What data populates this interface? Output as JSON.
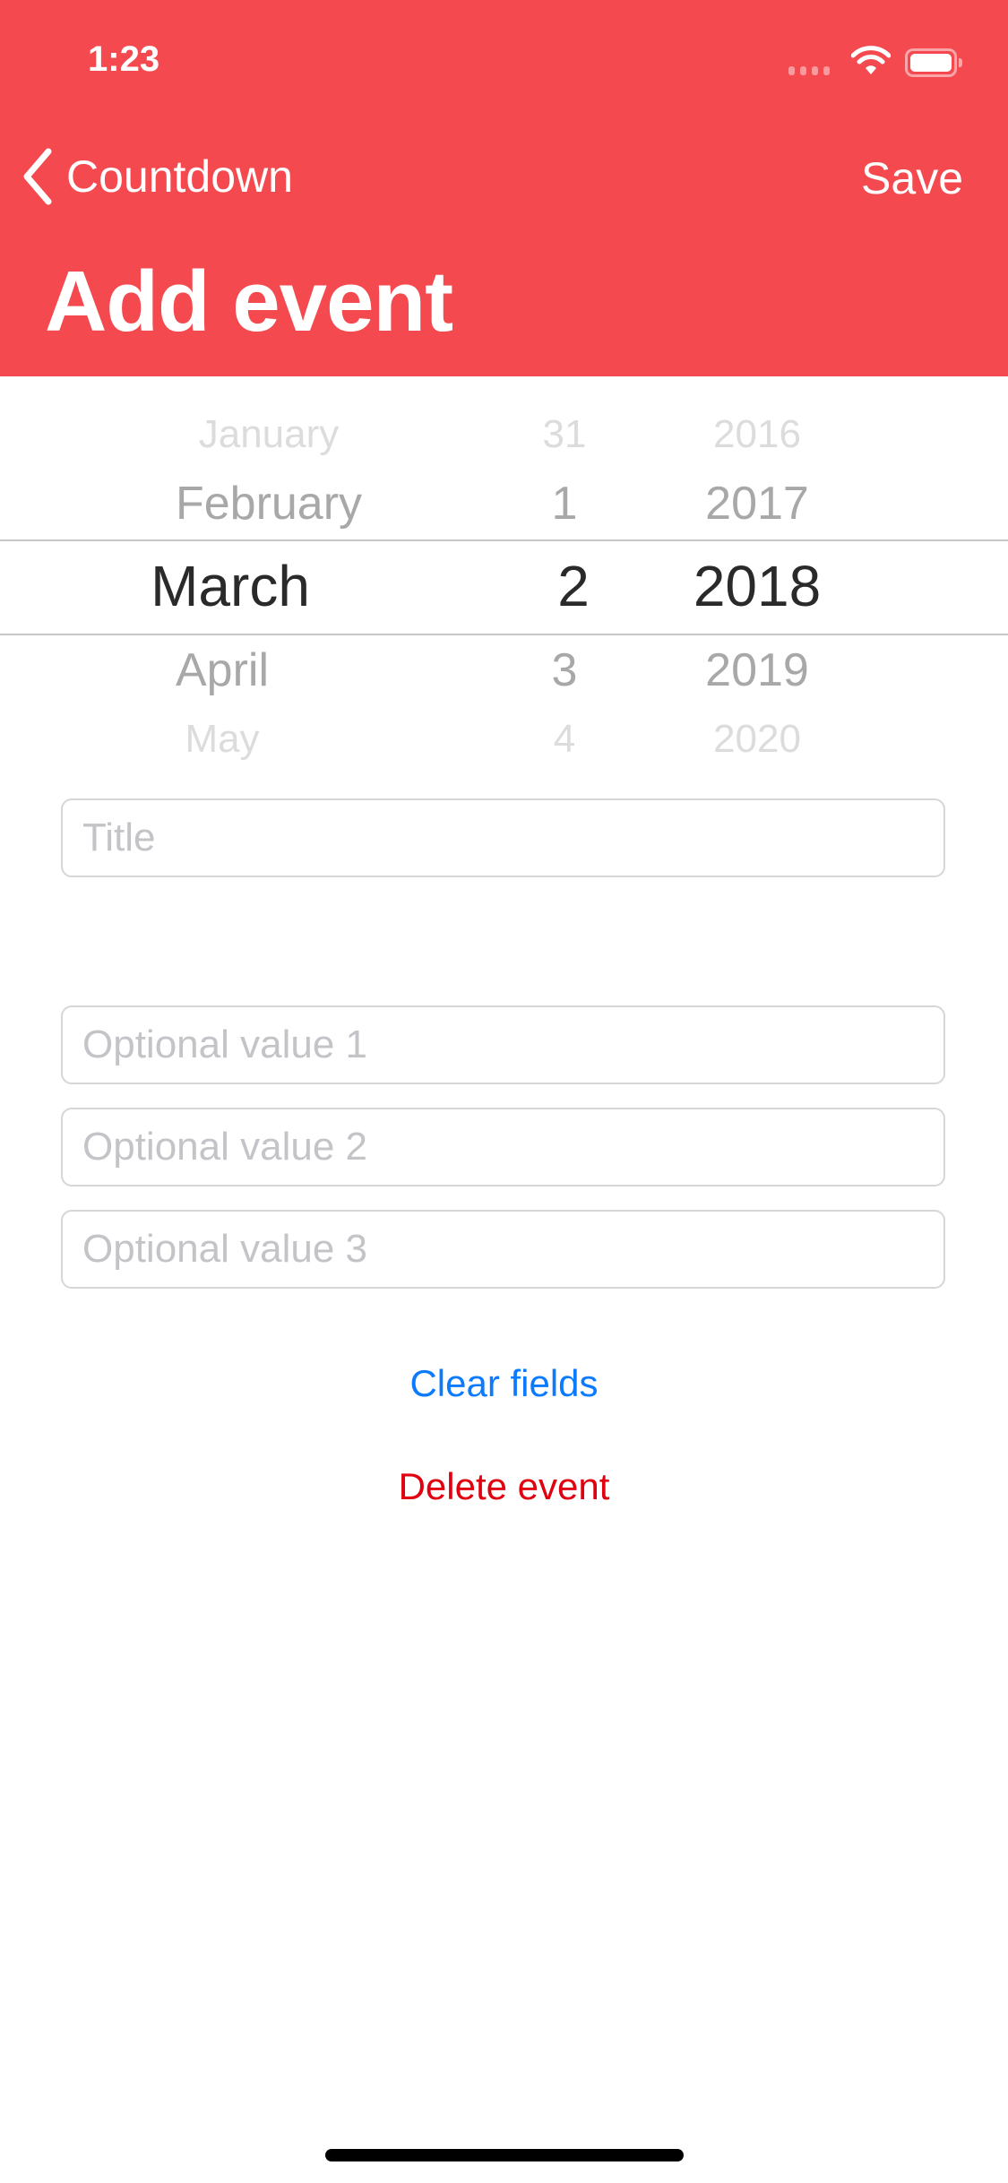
{
  "status_bar": {
    "time": "1:23",
    "signal_icon": "cellular-signal-icon",
    "wifi_icon": "wifi-icon",
    "battery_icon": "battery-icon"
  },
  "nav": {
    "back_label": "Countdown",
    "back_icon": "chevron-left-icon",
    "save_label": "Save",
    "title": "Add event"
  },
  "picker": {
    "months": [
      "January",
      "February",
      "March",
      "April",
      "May"
    ],
    "days": [
      "31",
      "1",
      "2",
      "3",
      "4"
    ],
    "years": [
      "2016",
      "2017",
      "2018",
      "2019",
      "2020"
    ],
    "selected": {
      "month": "March",
      "day": "2",
      "year": "2018"
    }
  },
  "form": {
    "title_placeholder": "Title",
    "optional1_placeholder": "Optional value 1",
    "optional2_placeholder": "Optional value 2",
    "optional3_placeholder": "Optional value 3"
  },
  "actions": {
    "clear_label": "Clear fields",
    "delete_label": "Delete event"
  },
  "colors": {
    "header": "#F44A4F",
    "link_blue": "#0A7AFF",
    "delete_red": "#E0000F"
  }
}
